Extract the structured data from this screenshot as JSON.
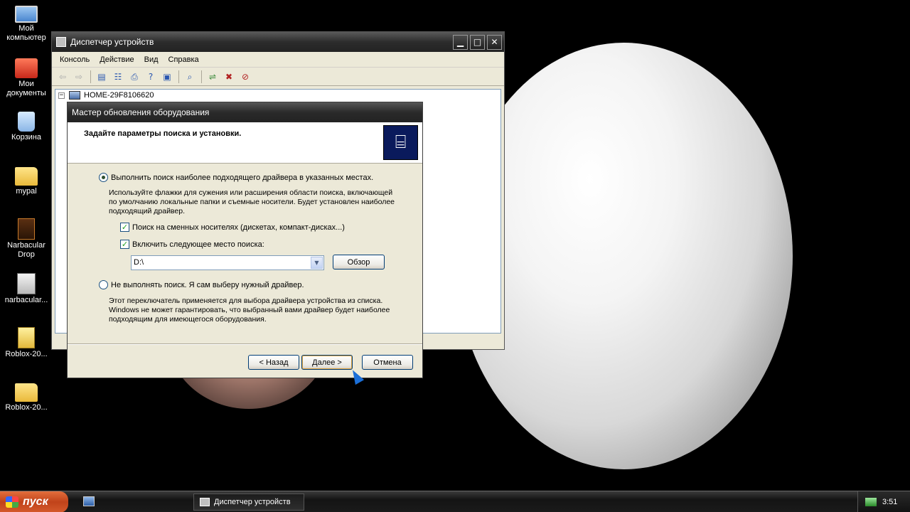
{
  "desktop": {
    "icons": [
      {
        "label_line1": "Мой",
        "label_line2": "компьютер",
        "icon": "my-computer-icon"
      },
      {
        "label_line1": "Мои",
        "label_line2": "документы",
        "icon": "my-documents-icon"
      },
      {
        "label_line1": "Корзина",
        "label_line2": "",
        "icon": "recycle-bin-icon"
      },
      {
        "label_line1": "mypal",
        "label_line2": "",
        "icon": "folder-icon"
      },
      {
        "label_line1": "Narbacular",
        "label_line2": "Drop",
        "icon": "narbacular-drop-icon"
      },
      {
        "label_line1": "narbacular...",
        "label_line2": "",
        "icon": "installer-icon"
      },
      {
        "label_line1": "Roblox-20...",
        "label_line2": "",
        "icon": "zip-folder-icon"
      },
      {
        "label_line1": "Roblox-20...",
        "label_line2": "",
        "icon": "folder-icon"
      }
    ]
  },
  "device_manager": {
    "title": "Диспетчер устройств",
    "menu": [
      "Консоль",
      "Действие",
      "Вид",
      "Справка"
    ],
    "tree_root": "HOME-29F8106620",
    "controls": {
      "minimize": "▁",
      "maximize": "□",
      "close": "✕"
    }
  },
  "wizard": {
    "title": "Мастер обновления оборудования",
    "header": "Задайте параметры поиска и установки.",
    "option1": {
      "label": "Выполнить поиск наиболее подходящего драйвера в указанных местах.",
      "selected": true,
      "description_lines": [
        "Используйте флажки для сужения или расширения области поиска, включающей",
        "по умолчанию локальные папки и съемные носители. Будет установлен наиболее",
        "подходящий драйвер."
      ]
    },
    "check_removable": {
      "label": "Поиск на сменных носителях (дискетах, компакт-дисках...)",
      "checked": true
    },
    "check_location": {
      "label": "Включить следующее место поиска:",
      "checked": true
    },
    "location_value": "D:\\",
    "browse_label": "Обзор",
    "option2": {
      "label": "Не выполнять поиск. Я сам выберу нужный драйвер.",
      "selected": false,
      "description_lines": [
        "Этот переключатель применяется для выбора драйвера устройства из списка.",
        "Windows не может гарантировать, что выбранный вами драйвер будет наиболее",
        "подходящим для имеющегося оборудования."
      ]
    },
    "buttons": {
      "back": "< Назад",
      "next": "Далее >",
      "cancel": "Отмена"
    }
  },
  "taskbar": {
    "start_label": "пуск",
    "task_label": "Диспетчер устройств",
    "clock": "3:51"
  }
}
